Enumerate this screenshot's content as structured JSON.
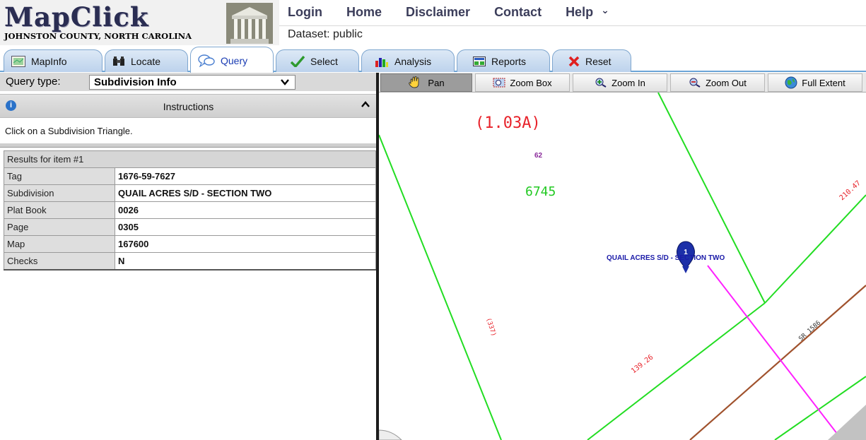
{
  "logo": {
    "title": "MapClick",
    "subtitle": "JOHNSTON COUNTY, NORTH CAROLINA"
  },
  "topnav": [
    "Login",
    "Home",
    "Disclaimer",
    "Contact",
    "Help"
  ],
  "help_chevron": "⌄",
  "dataset": "Dataset: public",
  "tabs": [
    {
      "label": "MapInfo",
      "icon": "map-icon"
    },
    {
      "label": "Locate",
      "icon": "binoculars-icon"
    },
    {
      "label": "Query",
      "icon": "speech-bubbles-icon",
      "active": true
    },
    {
      "label": "Select",
      "icon": "checkmark-icon"
    },
    {
      "label": "Analysis",
      "icon": "bar-chart-icon"
    },
    {
      "label": "Reports",
      "icon": "report-icon"
    },
    {
      "label": "Reset",
      "icon": "x-icon"
    }
  ],
  "query": {
    "label": "Query type:",
    "selected": "Subdivision Info"
  },
  "instructions": {
    "header": "Instructions",
    "text": "Click on a Subdivision Triangle."
  },
  "results": {
    "header": "Results for item #1",
    "rows": [
      {
        "key": "Tag",
        "value": "1676-59-7627"
      },
      {
        "key": "Subdivision",
        "value": "QUAIL ACRES S/D - SECTION TWO"
      },
      {
        "key": "Plat Book",
        "value": "0026"
      },
      {
        "key": "Page",
        "value": "0305"
      },
      {
        "key": "Map",
        "value": "167600"
      },
      {
        "key": "Checks",
        "value": "N"
      }
    ]
  },
  "map_toolbar": [
    {
      "label": "Pan",
      "icon": "hand-icon",
      "active": true
    },
    {
      "label": "Zoom Box",
      "icon": "zoom-box-icon"
    },
    {
      "label": "Zoom In",
      "icon": "zoom-in-icon"
    },
    {
      "label": "Zoom Out",
      "icon": "zoom-out-icon"
    },
    {
      "label": "Full Extent",
      "icon": "globe-icon"
    }
  ],
  "map_labels": {
    "acreage": "(1.03A)",
    "lot_number": "62",
    "parcel_number": "6745",
    "subdivision": "QUAIL ACRES S/D - SECTION TWO",
    "marker_number": "1",
    "dim_a": "210.47",
    "dim_b": "139.26",
    "dim_c": "(337)",
    "road": "SR 1586"
  },
  "colors": {
    "parcel_line": "#22dd22",
    "road_line": "#a0522d",
    "magenta_line": "#ff20ff",
    "dimension_text": "#e8222a",
    "subdivision_text": "#1a1aa8",
    "active_tab_text": "#1a3cb3"
  }
}
